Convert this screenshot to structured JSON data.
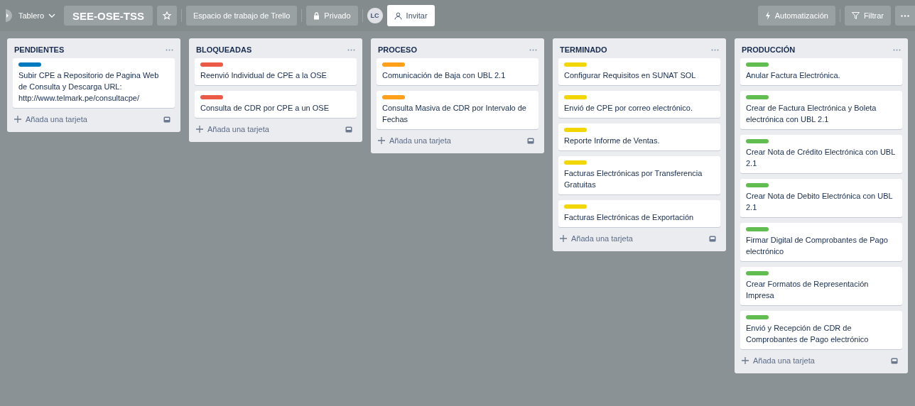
{
  "header": {
    "board_menu": "Tablero",
    "board_title": "SEE-OSE-TSS",
    "workspace": "Espacio de trabajo de Trello",
    "visibility": "Privado",
    "member_initials": "LC",
    "invite": "Invitar",
    "automation": "Automatización",
    "filter": "Filtrar"
  },
  "lists": [
    {
      "title": "PENDIENTES",
      "add_card": "Añada una tarjeta",
      "cards": [
        {
          "color": "#0079bf",
          "text": "Subir CPE a Repositorio de Pagina Web de Consulta y Descarga URL: http://www.telmark.pe/consultacpe/"
        }
      ]
    },
    {
      "title": "BLOQUEADAS",
      "add_card": "Añada una tarjeta",
      "cards": [
        {
          "color": "#eb5a46",
          "text": "Reenvió Individual de CPE a la OSE"
        },
        {
          "color": "#eb5a46",
          "text": "Consulta de CDR por CPE a un OSE"
        }
      ]
    },
    {
      "title": "PROCESO",
      "add_card": "Añada una tarjeta",
      "cards": [
        {
          "color": "#ff9f1a",
          "text": "Comunicación de Baja con UBL 2.1"
        },
        {
          "color": "#ff9f1a",
          "text": "Consulta Masiva de CDR por Intervalo de Fechas"
        }
      ]
    },
    {
      "title": "TERMINADO",
      "add_card": "Añada una tarjeta",
      "cards": [
        {
          "color": "#f2d600",
          "text": "Configurar Requisitos en SUNAT SOL"
        },
        {
          "color": "#f2d600",
          "text": "Envió de CPE por correo electrónico."
        },
        {
          "color": "#f2d600",
          "text": "Reporte Informe de Ventas."
        },
        {
          "color": "#f2d600",
          "text": "Facturas Electrónicas por Transferencia Gratuitas"
        },
        {
          "color": "#f2d600",
          "text": "Facturas Electrónicas de Exportación"
        }
      ]
    },
    {
      "title": "PRODUCCIÓN",
      "add_card": "Añada una tarjeta",
      "cards": [
        {
          "color": "#61bd4f",
          "text": "Anular Factura Electrónica."
        },
        {
          "color": "#61bd4f",
          "text": "Crear de Factura Electrónica y Boleta electrónica con UBL 2.1"
        },
        {
          "color": "#61bd4f",
          "text": "Crear Nota de Crédito Electrónica con UBL 2.1"
        },
        {
          "color": "#61bd4f",
          "text": "Crear Nota de Debito Electrónica con UBL 2.1"
        },
        {
          "color": "#61bd4f",
          "text": "Firmar Digital de Comprobantes de Pago electrónico"
        },
        {
          "color": "#61bd4f",
          "text": "Crear Formatos de Representación Impresa"
        },
        {
          "color": "#61bd4f",
          "text": "Envió y Recepción de CDR de Comprobantes de Pago electrónico"
        }
      ]
    }
  ]
}
